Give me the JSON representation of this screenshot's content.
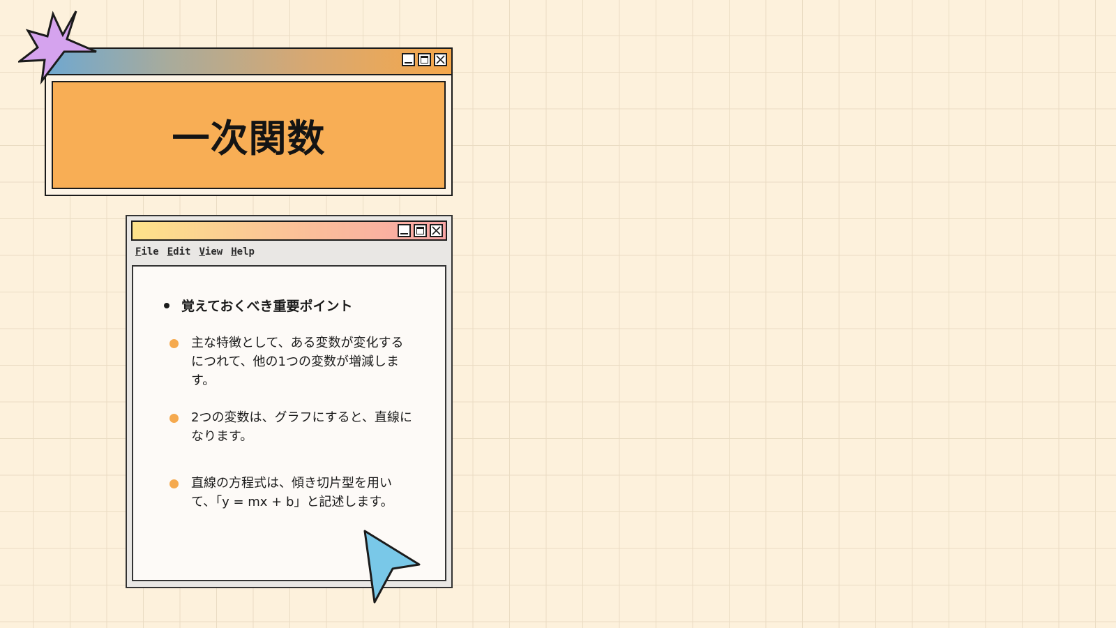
{
  "title_window": {
    "title": "一次関数"
  },
  "notes_window": {
    "menu": [
      {
        "ul": "F",
        "rest": "ile"
      },
      {
        "ul": "E",
        "rest": "dit"
      },
      {
        "ul": "V",
        "rest": "iew"
      },
      {
        "ul": "H",
        "rest": "elp"
      }
    ],
    "heading": "覚えておくべき重要ポイント",
    "points": [
      "主な特徴として、ある変数が変化するにつれて、他の1つの変数が増減します。",
      "2つの変数は、グラフにすると、直線になります。",
      "直線の方程式は、傾き切片型を用いて、「y = mx + b」と記述します。"
    ]
  },
  "colors": {
    "background": "#fdf1dc",
    "title_panel": "#f8ae55",
    "bullet_orange": "#f5a94e",
    "starburst": "#d5a3ee",
    "cursor": "#79c8e8"
  },
  "icons": [
    "starburst-icon",
    "minimize-icon",
    "maximize-icon",
    "close-icon",
    "pointer-cursor-icon"
  ]
}
